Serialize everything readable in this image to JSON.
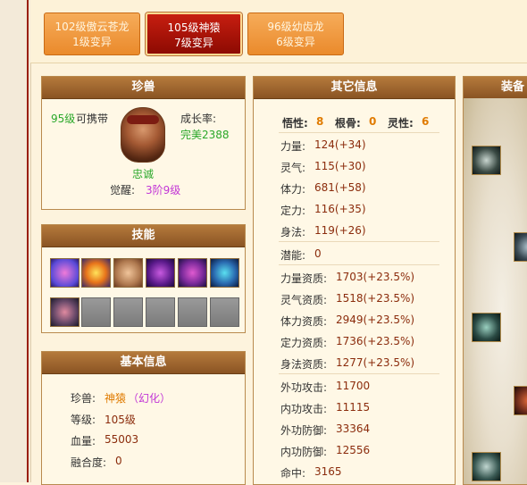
{
  "tabs": [
    {
      "line1": "102级傲云苍龙",
      "line2": "1级变异"
    },
    {
      "line1": "105级神猿",
      "line2": "7级变异"
    },
    {
      "line1": "96级幼齿龙",
      "line2": "6级变异"
    }
  ],
  "pet": {
    "title": "珍兽",
    "level": "95级",
    "carry_label": "可携带",
    "growth_label": "成长率:",
    "growth_value": "完美2388",
    "temper": "忠诚",
    "awaken_label": "觉醒:",
    "awaken_value": "3阶9级"
  },
  "skills": {
    "title": "技能",
    "row1": [
      "skill-1-icon",
      "skill-2-icon",
      "skill-3-icon",
      "skill-4-icon",
      "skill-5-icon",
      "skill-6-icon"
    ],
    "row2": [
      "skill-7-icon",
      "empty-slot",
      "empty-slot",
      "empty-slot",
      "empty-slot",
      "empty-slot"
    ]
  },
  "basic": {
    "title": "基本信息",
    "pet_label": "珍兽:",
    "pet_value": "神猿",
    "pet_variant": "（幻化）",
    "level_label": "等级:",
    "level_value": "105级",
    "hp_label": "血量:",
    "hp_value": "55003",
    "fusion_label": "融合度:",
    "fusion_value": "0"
  },
  "other": {
    "title": "其它信息",
    "wuxing_label": "悟性:",
    "wuxing_value": "8",
    "gengu_label": "根骨:",
    "gengu_value": "0",
    "lingxing_label": "灵性:",
    "lingxing_value": "6",
    "attrs": [
      {
        "label": "力量:",
        "value": "124(+34)"
      },
      {
        "label": "灵气:",
        "value": "115(+30)"
      },
      {
        "label": "体力:",
        "value": "681(+58)"
      },
      {
        "label": "定力:",
        "value": "116(+35)"
      },
      {
        "label": "身法:",
        "value": "119(+26)"
      }
    ],
    "potential_label": "潜能:",
    "potential_value": "0",
    "aptitudes": [
      {
        "label": "力量资质:",
        "value": "1703(+23.5%)"
      },
      {
        "label": "灵气资质:",
        "value": "1518(+23.5%)"
      },
      {
        "label": "体力资质:",
        "value": "2949(+23.5%)"
      },
      {
        "label": "定力资质:",
        "value": "1736(+23.5%)"
      },
      {
        "label": "身法资质:",
        "value": "1277(+23.5%)"
      }
    ],
    "combat": [
      {
        "label": "外功攻击:",
        "value": "11700"
      },
      {
        "label": "内功攻击:",
        "value": "11115"
      },
      {
        "label": "外功防御:",
        "value": "33364"
      },
      {
        "label": "内功防御:",
        "value": "12556"
      },
      {
        "label": "命中:",
        "value": "3165"
      }
    ]
  },
  "equip": {
    "title": "装备"
  }
}
